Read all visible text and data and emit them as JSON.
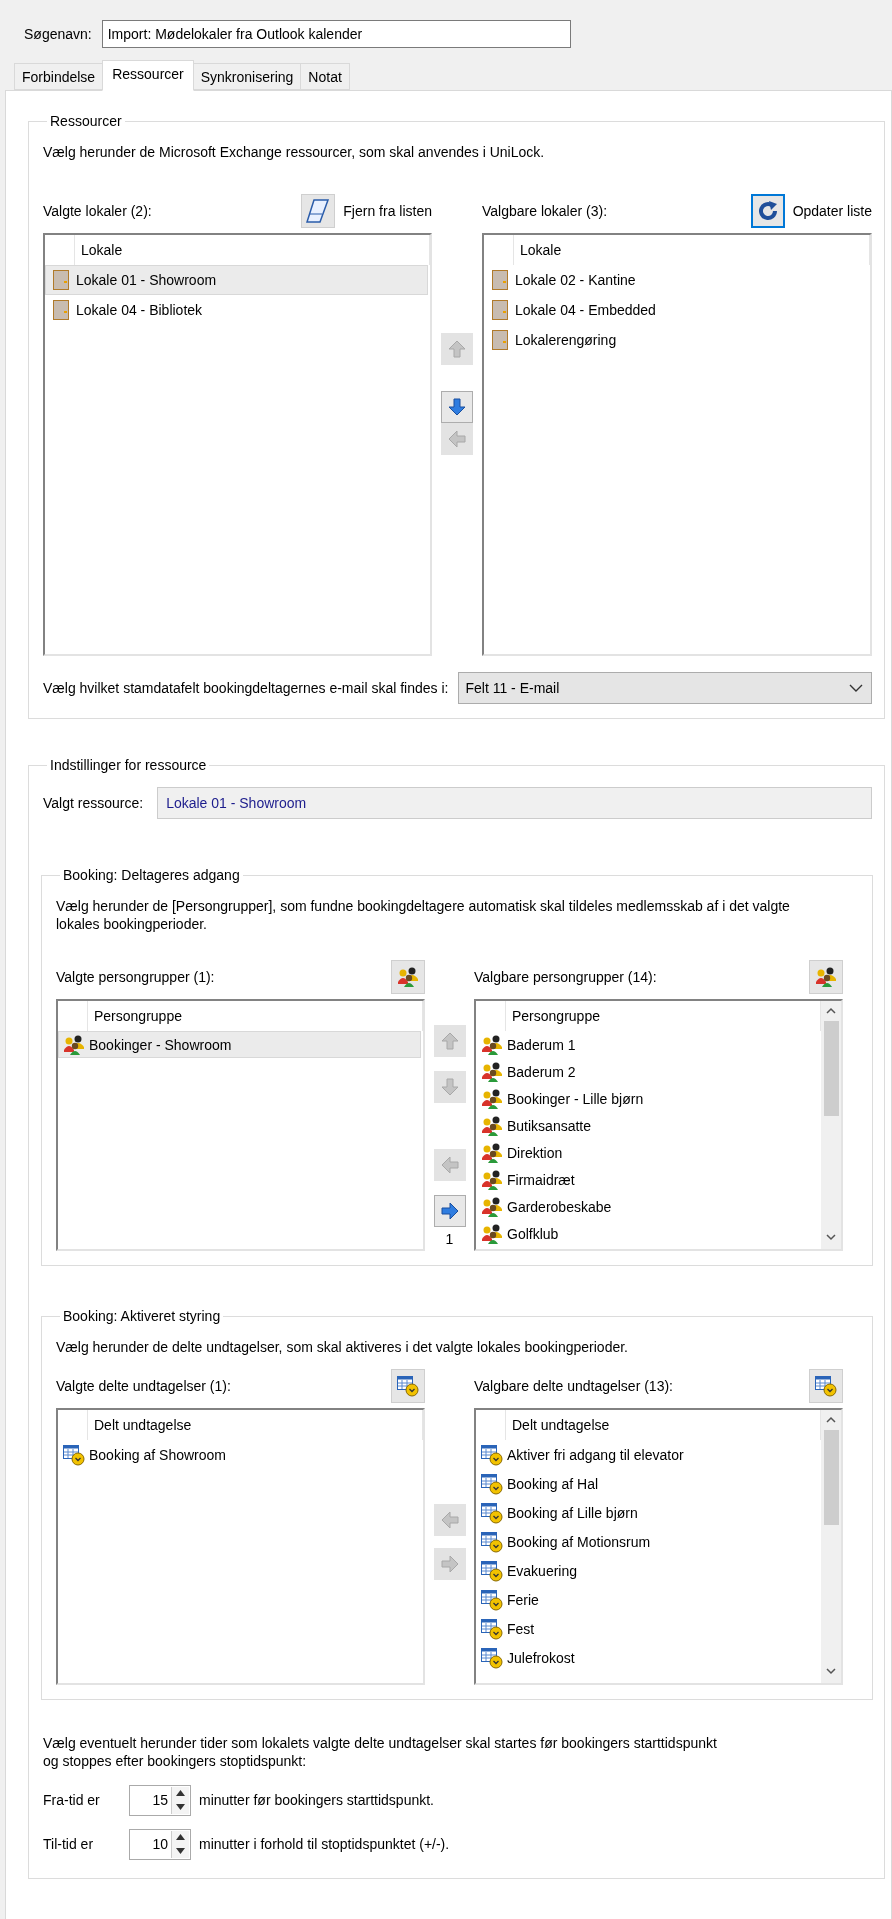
{
  "search_name": {
    "label": "Søgenavn:",
    "value": "Import: Mødelokaler fra Outlook kalender"
  },
  "tabs": [
    {
      "label": "Forbindelse",
      "selected": false
    },
    {
      "label": "Ressourcer",
      "selected": true
    },
    {
      "label": "Synkronisering",
      "selected": false
    },
    {
      "label": "Notat",
      "selected": false
    }
  ],
  "resources_group": {
    "title": "Ressourcer",
    "description": "Vælg herunder de Microsoft Exchange ressourcer, som skal anvendes i UniLock.",
    "selected_list": {
      "label": "Valgte lokaler (2):",
      "action": {
        "kind": "eraser",
        "label": "Fjern fra listen",
        "focused": false
      },
      "kind": "door",
      "scrollbar": false,
      "column": "Lokale",
      "items": [
        {
          "name": "Lokale 01 - Showroom",
          "selected": true
        },
        {
          "name": "Lokale 04 - Bibliotek",
          "selected": false
        }
      ]
    },
    "arrows": [
      {
        "kind": "up",
        "disabled": true
      },
      {
        "kind": "down",
        "disabled": false
      },
      {
        "kind": "left",
        "disabled": true
      }
    ],
    "available_list": {
      "label": "Valgbare lokaler (3):",
      "action": {
        "kind": "refresh",
        "label": "Opdater liste",
        "focused": true
      },
      "kind": "door",
      "scrollbar": false,
      "column": "Lokale",
      "items": [
        {
          "name": "Lokale 02 - Kantine",
          "selected": false
        },
        {
          "name": "Lokale 04 - Embedded",
          "selected": false
        },
        {
          "name": "Lokalerengøring",
          "selected": false
        }
      ]
    },
    "email_field": {
      "label": "Vælg hvilket stamdatafelt bookingdeltagernes e-mail skal findes i:",
      "value": "Felt 11 - E-mail"
    }
  },
  "settings_group": {
    "title": "Indstillinger for ressource",
    "selected_resource": {
      "label": "Valgt ressource:",
      "value": "Lokale 01 - Showroom"
    },
    "access_group": {
      "title": "Booking: Deltageres adgang",
      "description": "Vælg herunder de [Persongrupper], som fundne bookingdeltagere automatisk skal tildeles medlemsskab af i det valgte lokales bookingperioder.",
      "selected_list": {
        "label": "Valgte persongrupper (1):",
        "action": {
          "kind": "icon"
        },
        "kind": "group",
        "scrollbar": false,
        "column": "Persongruppe",
        "items": [
          {
            "name": "Bookinger - Showroom",
            "selected": true
          }
        ]
      },
      "arrows": [
        {
          "kind": "up",
          "disabled": true
        },
        {
          "kind": "down",
          "disabled": true
        },
        {
          "kind": "left",
          "disabled": true
        },
        {
          "kind": "right",
          "disabled": false
        }
      ],
      "count": "1",
      "available_list": {
        "label": "Valgbare persongrupper (14):",
        "action": {
          "kind": "icon"
        },
        "kind": "group",
        "scrollbar": true,
        "column": "Persongruppe",
        "items": [
          {
            "name": "Baderum 1",
            "selected": false
          },
          {
            "name": "Baderum 2",
            "selected": false
          },
          {
            "name": "Bookinger - Lille bjørn",
            "selected": false
          },
          {
            "name": "Butiksansatte",
            "selected": false
          },
          {
            "name": "Direktion",
            "selected": false
          },
          {
            "name": "Firmaidræt",
            "selected": false
          },
          {
            "name": "Garderobeskabe",
            "selected": false
          },
          {
            "name": "Golfklub",
            "selected": false
          }
        ]
      }
    },
    "control_group": {
      "title": "Booking: Aktiveret styring",
      "description": "Vælg herunder de delte undtagelser, som skal aktiveres i det valgte lokales bookingperioder.",
      "selected_list": {
        "label": "Valgte delte undtagelser (1):",
        "action": {
          "kind": "icon"
        },
        "kind": "calendar",
        "scrollbar": false,
        "column": "Delt undtagelse",
        "items": [
          {
            "name": "Booking af Showroom",
            "selected": false
          }
        ]
      },
      "arrows": [
        {
          "kind": "left",
          "disabled": true
        },
        {
          "kind": "right",
          "disabled": true
        }
      ],
      "available_list": {
        "label": "Valgbare delte undtagelser (13):",
        "action": {
          "kind": "icon"
        },
        "kind": "calendar",
        "scrollbar": true,
        "column": "Delt undtagelse",
        "items": [
          {
            "name": "Aktiver fri adgang til elevator",
            "selected": false
          },
          {
            "name": "Booking af Hal",
            "selected": false
          },
          {
            "name": "Booking af Lille bjørn",
            "selected": false
          },
          {
            "name": "Booking af Motionsrum",
            "selected": false
          },
          {
            "name": "Evakuering",
            "selected": false
          },
          {
            "name": "Ferie",
            "selected": false
          },
          {
            "name": "Fest",
            "selected": false
          },
          {
            "name": "Julefrokost",
            "selected": false
          }
        ]
      }
    },
    "offset_description": "Vælg eventuelt herunder tider som lokalets valgte delte undtagelser skal startes før bookingers starttidspunkt og stoppes efter bookingers stoptidspunkt:",
    "offsets": [
      {
        "label": "Fra-tid er",
        "value": "15",
        "suffix": "minutter før bookingers starttidspunkt."
      },
      {
        "label": "Til-tid er",
        "value": "10",
        "suffix": "minutter i forhold til stoptidspunktet (+/-)."
      }
    ]
  }
}
